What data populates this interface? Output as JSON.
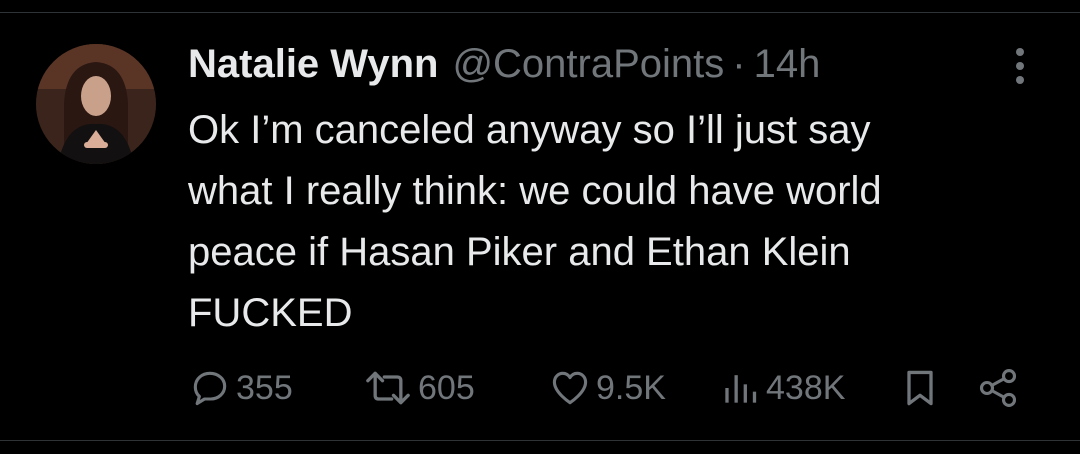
{
  "tweet": {
    "author": {
      "name": "Natalie Wynn",
      "handle": "@ContraPoints",
      "separator": "·",
      "time": "14h"
    },
    "text_lines": [
      "Ok I’m canceled anyway so I’ll just say",
      "what I really think: we could have world",
      "peace if Hasan Piker and Ethan Klein",
      "FUCKED"
    ],
    "actions": {
      "replies": "355",
      "reposts": "605",
      "likes": "9.5K",
      "views": "438K"
    }
  },
  "icons": [
    "avatar",
    "more-icon",
    "reply-icon",
    "repost-icon",
    "like-icon",
    "views-icon",
    "bookmark-icon",
    "share-icon"
  ],
  "colors": {
    "background": "#000000",
    "text": "#e7e9ea",
    "muted": "#71767b",
    "divider": "#2f3336"
  }
}
